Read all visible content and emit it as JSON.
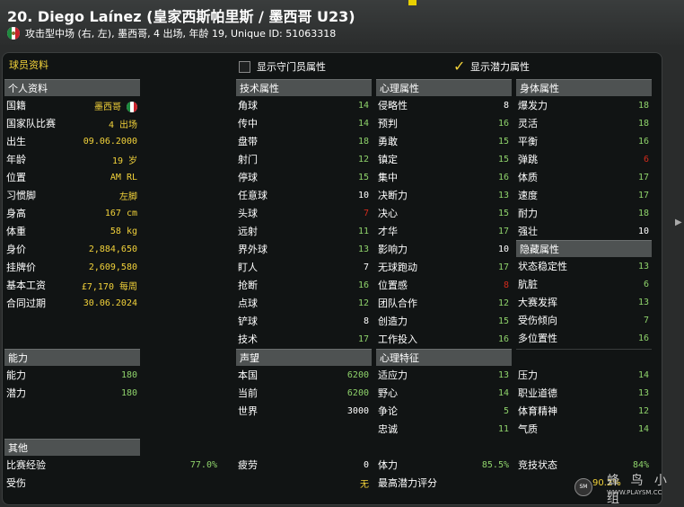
{
  "header": {
    "title": "20. Diego Laínez (皇家西斯帕里斯 / 墨西哥 U23)",
    "subtitle": "攻击型中场 (右, 左), 墨西哥, 4 出场, 年龄 19, Unique ID: 51063318"
  },
  "toolbar": {
    "section_label": "球员资料",
    "gk_toggle_label": "显示守门员属性",
    "gk_toggle_checked": false,
    "potential_toggle_label": "显示潜力属性",
    "potential_toggle_checked": true
  },
  "personal": {
    "title": "个人资料",
    "rows": [
      {
        "label": "国籍",
        "value": "墨西哥",
        "color": "y"
      },
      {
        "label": "国家队比赛",
        "value": "4 出场",
        "color": "y"
      },
      {
        "label": "出生",
        "value": "09.06.2000",
        "color": "y"
      },
      {
        "label": "年龄",
        "value": "19 岁",
        "color": "y"
      },
      {
        "label": "位置",
        "value": "AM RL",
        "color": "y"
      },
      {
        "label": "习惯脚",
        "value": "左脚",
        "color": "y"
      },
      {
        "label": "身高",
        "value": "167 cm",
        "color": "y"
      },
      {
        "label": "体重",
        "value": "58 kg",
        "color": "y"
      },
      {
        "label": "身价",
        "value": "2,884,650",
        "color": "y"
      },
      {
        "label": "挂牌价",
        "value": "2,609,580",
        "color": "y"
      },
      {
        "label": "基本工资",
        "value": "£7,170 每周",
        "color": "y"
      },
      {
        "label": "合同过期",
        "value": "30.06.2024",
        "color": "y"
      }
    ]
  },
  "technical": {
    "title": "技术属性",
    "rows": [
      {
        "label": "角球",
        "value": "14",
        "color": "g"
      },
      {
        "label": "传中",
        "value": "14",
        "color": "g"
      },
      {
        "label": "盘带",
        "value": "18",
        "color": "g"
      },
      {
        "label": "射门",
        "value": "12",
        "color": "g"
      },
      {
        "label": "停球",
        "value": "15",
        "color": "g"
      },
      {
        "label": "任意球",
        "value": "10",
        "color": "w"
      },
      {
        "label": "头球",
        "value": "7",
        "color": "r"
      },
      {
        "label": "远射",
        "value": "11",
        "color": "g"
      },
      {
        "label": "界外球",
        "value": "13",
        "color": "g"
      },
      {
        "label": "盯人",
        "value": "7",
        "color": "w"
      },
      {
        "label": "抢断",
        "value": "16",
        "color": "g"
      },
      {
        "label": "点球",
        "value": "12",
        "color": "g"
      },
      {
        "label": "铲球",
        "value": "8",
        "color": "w"
      },
      {
        "label": "技术",
        "value": "17",
        "color": "g"
      }
    ]
  },
  "mental": {
    "title": "心理属性",
    "rows": [
      {
        "label": "侵略性",
        "value": "8",
        "color": "w"
      },
      {
        "label": "预判",
        "value": "16",
        "color": "g"
      },
      {
        "label": "勇敢",
        "value": "15",
        "color": "g"
      },
      {
        "label": "镇定",
        "value": "15",
        "color": "g"
      },
      {
        "label": "集中",
        "value": "16",
        "color": "g"
      },
      {
        "label": "决断力",
        "value": "13",
        "color": "g"
      },
      {
        "label": "决心",
        "value": "15",
        "color": "g"
      },
      {
        "label": "才华",
        "value": "17",
        "color": "g"
      },
      {
        "label": "影响力",
        "value": "10",
        "color": "w"
      },
      {
        "label": "无球跑动",
        "value": "17",
        "color": "g"
      },
      {
        "label": "位置感",
        "value": "8",
        "color": "r"
      },
      {
        "label": "团队合作",
        "value": "12",
        "color": "g"
      },
      {
        "label": "创造力",
        "value": "15",
        "color": "g"
      },
      {
        "label": "工作投入",
        "value": "16",
        "color": "g"
      }
    ]
  },
  "physical": {
    "title": "身体属性",
    "rows": [
      {
        "label": "爆发力",
        "value": "18",
        "color": "g"
      },
      {
        "label": "灵活",
        "value": "18",
        "color": "g"
      },
      {
        "label": "平衡",
        "value": "16",
        "color": "g"
      },
      {
        "label": "弹跳",
        "value": "6",
        "color": "r"
      },
      {
        "label": "体质",
        "value": "17",
        "color": "g"
      },
      {
        "label": "速度",
        "value": "17",
        "color": "g"
      },
      {
        "label": "耐力",
        "value": "18",
        "color": "g"
      },
      {
        "label": "强壮",
        "value": "10",
        "color": "w"
      }
    ]
  },
  "hidden": {
    "title": "隐藏属性",
    "rows": [
      {
        "label": "状态稳定性",
        "value": "13",
        "color": "g"
      },
      {
        "label": "肮脏",
        "value": "6",
        "color": "g"
      },
      {
        "label": "大赛发挥",
        "value": "13",
        "color": "g"
      },
      {
        "label": "受伤倾向",
        "value": "7",
        "color": "g"
      },
      {
        "label": "多位置性",
        "value": "16",
        "color": "g"
      }
    ]
  },
  "ability": {
    "title": "能力",
    "rows": [
      {
        "label": "能力",
        "value": "180",
        "color": "g"
      },
      {
        "label": "潜力",
        "value": "180",
        "color": "g"
      }
    ]
  },
  "reputation": {
    "title": "声望",
    "rows": [
      {
        "label": "本国",
        "value": "6200",
        "color": "g"
      },
      {
        "label": "当前",
        "value": "6200",
        "color": "g"
      },
      {
        "label": "世界",
        "value": "3000",
        "color": "w"
      }
    ]
  },
  "personality": {
    "title": "心理特征",
    "left_rows": [
      {
        "label": "适应力",
        "value": "13",
        "color": "g"
      },
      {
        "label": "野心",
        "value": "14",
        "color": "g"
      },
      {
        "label": "争论",
        "value": "5",
        "color": "g"
      },
      {
        "label": "忠诚",
        "value": "11",
        "color": "g"
      }
    ],
    "right_rows": [
      {
        "label": "压力",
        "value": "14",
        "color": "g"
      },
      {
        "label": "职业道德",
        "value": "13",
        "color": "g"
      },
      {
        "label": "体育精神",
        "value": "12",
        "color": "g"
      },
      {
        "label": "气质",
        "value": "14",
        "color": "g"
      }
    ]
  },
  "other": {
    "title": "其他",
    "match_exp_label": "比赛经验",
    "match_exp_value": "77.0%",
    "fatigue_label": "疲劳",
    "fatigue_value": "0",
    "stamina_label": "体力",
    "stamina_value": "85.5%",
    "condition_label": "竞技状态",
    "condition_value": "84%",
    "injury_label": "受伤",
    "injury_value": "无",
    "max_pa_label": "最高潜力评分",
    "max_pa_value": "90.2%"
  },
  "watermark": {
    "text": "蜂 鸟 小 组",
    "url": "WWW.PLAYSM.CC",
    "badge": "SM"
  },
  "colors": {
    "green": "#8fd36b",
    "yellow": "#f2d23a",
    "red": "#d32b1c",
    "header_bg": "#4e5252"
  }
}
